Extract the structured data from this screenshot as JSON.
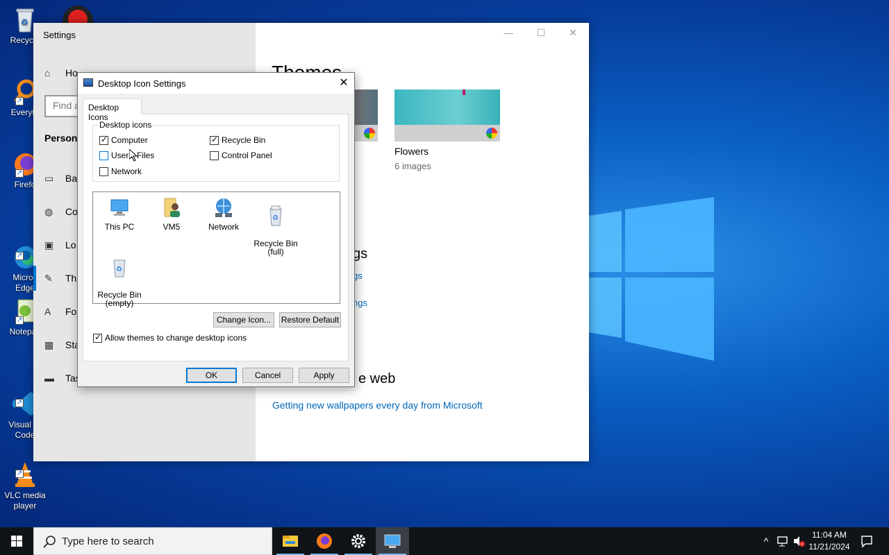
{
  "desktop": {
    "icons": [
      {
        "label": "Recycle",
        "icon": "recycle-bin-icon"
      },
      {
        "label": "Everyth",
        "icon": "everything-search-icon"
      },
      {
        "label": "Firefo",
        "icon": "firefox-icon"
      },
      {
        "label": "Micros\nEdge",
        "icon": "edge-icon"
      },
      {
        "label": "Notepac",
        "icon": "notepad-plus-icon"
      },
      {
        "label": "Visual St\nCode",
        "icon": "vscode-icon"
      },
      {
        "label": "VLC media\nplayer",
        "icon": "vlc-icon"
      }
    ]
  },
  "settings": {
    "title": "Settings",
    "home": "Ho",
    "find_placeholder": "Find a",
    "section": "Persona",
    "nav": [
      "Ba",
      "Co",
      "Lo",
      "Th",
      "Fo",
      "Sta",
      "Tas"
    ],
    "page_title": "Themes",
    "theme_name": "Flowers",
    "theme_count": "6 images",
    "related_heading": "gs",
    "related_links": [
      "gs",
      "ngs"
    ],
    "web_heading": "e web",
    "web_link": "Getting new wallpapers every day from Microsoft",
    "controls": {
      "minimize": "—",
      "maximize": "☐",
      "close": "✕"
    }
  },
  "dialog": {
    "title": "Desktop Icon Settings",
    "close": "✕",
    "tab": "Desktop Icons",
    "group_label": "Desktop icons",
    "checkboxes": [
      {
        "label": "Computer",
        "checked": true
      },
      {
        "label": "Recycle Bin",
        "checked": true
      },
      {
        "label": "User's Files",
        "checked": false
      },
      {
        "label": "Control Panel",
        "checked": false
      },
      {
        "label": "Network",
        "checked": false
      }
    ],
    "icons": [
      {
        "label": "This PC",
        "icon": "this-pc-icon"
      },
      {
        "label": "VM5",
        "icon": "user-folder-icon"
      },
      {
        "label": "Network",
        "icon": "network-icon"
      },
      {
        "label": "Recycle Bin\n(full)",
        "icon": "recycle-bin-full-icon"
      },
      {
        "label": "Recycle Bin\n(empty)",
        "icon": "recycle-bin-empty-icon"
      }
    ],
    "change_icon": "Change Icon...",
    "restore_default": "Restore Default",
    "allow_themes": "Allow themes to change desktop icons",
    "allow_themes_checked": true,
    "ok": "OK",
    "cancel": "Cancel",
    "apply": "Apply"
  },
  "taskbar": {
    "search_placeholder": "Type here to search",
    "apps": [
      "file-explorer-icon",
      "firefox-icon",
      "settings-gear-icon",
      "desktop-settings-icon"
    ],
    "tray": {
      "chevron": "^",
      "network": "network-tray-icon",
      "volume": "volume-muted-icon",
      "notifications": "notification-icon"
    },
    "time": "11:04 AM",
    "date": "11/21/2024"
  },
  "colors": {
    "accent": "#0078d7",
    "link": "#0067b8",
    "taskbar": "#101418"
  }
}
